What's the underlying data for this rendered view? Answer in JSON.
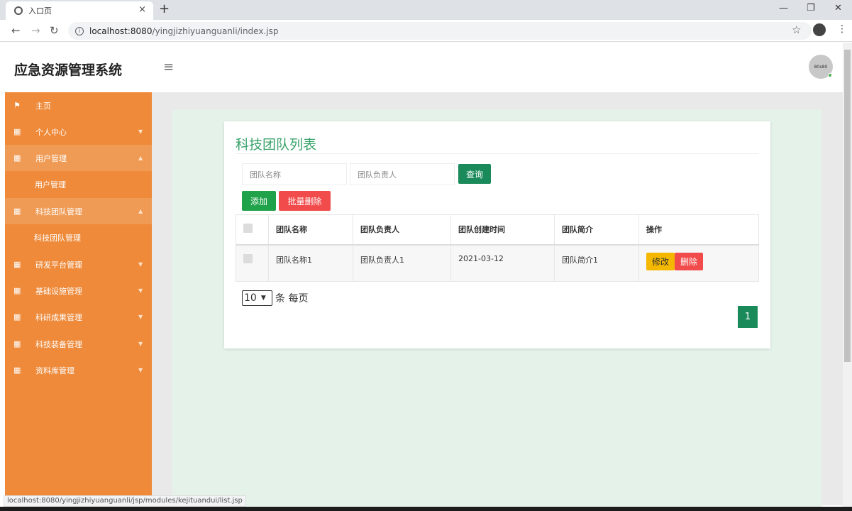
{
  "browser": {
    "tab_title": "入口页",
    "tab_close": "×",
    "new_tab": "+",
    "url_host": "localhost:8080",
    "url_path": "/yingjizhiyuanguanli/index.jsp",
    "status_url": "localhost:8080/yingjizhiyuanguanli/jsp/modules/kejituandui/list.jsp"
  },
  "header": {
    "app_title": "应急资源管理系统",
    "avatar_text": "80x80"
  },
  "sidebar": {
    "items": [
      {
        "label": "主页",
        "icon": "flag-icon"
      },
      {
        "label": "个人中心",
        "icon": "grid-icon"
      },
      {
        "label": "用户管理",
        "icon": "grid-icon"
      },
      {
        "label": "用户管理",
        "icon": ""
      },
      {
        "label": "科技团队管理",
        "icon": "grid-icon"
      },
      {
        "label": "科技团队管理",
        "icon": ""
      },
      {
        "label": "研发平台管理",
        "icon": "grid-icon"
      },
      {
        "label": "基础设施管理",
        "icon": "grid-icon"
      },
      {
        "label": "科研成果管理",
        "icon": "grid-icon"
      },
      {
        "label": "科技装备管理",
        "icon": "grid-icon"
      },
      {
        "label": "资料库管理",
        "icon": "grid-icon"
      }
    ]
  },
  "main": {
    "card_title": "科技团队列表",
    "search": {
      "name_placeholder": "团队名称",
      "leader_placeholder": "团队负责人",
      "query_label": "查询"
    },
    "actions": {
      "add_label": "添加",
      "batch_delete_label": "批量删除"
    },
    "table": {
      "headers": [
        "团队名称",
        "团队负责人",
        "团队创建时间",
        "团队简介",
        "操作"
      ],
      "rows": [
        {
          "name": "团队名称1",
          "leader": "团队负责人1",
          "created": "2021-03-12",
          "intro": "团队简介1",
          "edit": "修改",
          "delete": "删除"
        }
      ]
    },
    "pagination": {
      "page_size": "10",
      "per_page_text": "条 每页",
      "current_page": "1"
    }
  },
  "colors": {
    "sidebar": "#ee8a3a",
    "title_green": "#3aa36b",
    "primary": "#1a8a5a",
    "danger": "#f24b4b",
    "warning": "#f5b800"
  }
}
